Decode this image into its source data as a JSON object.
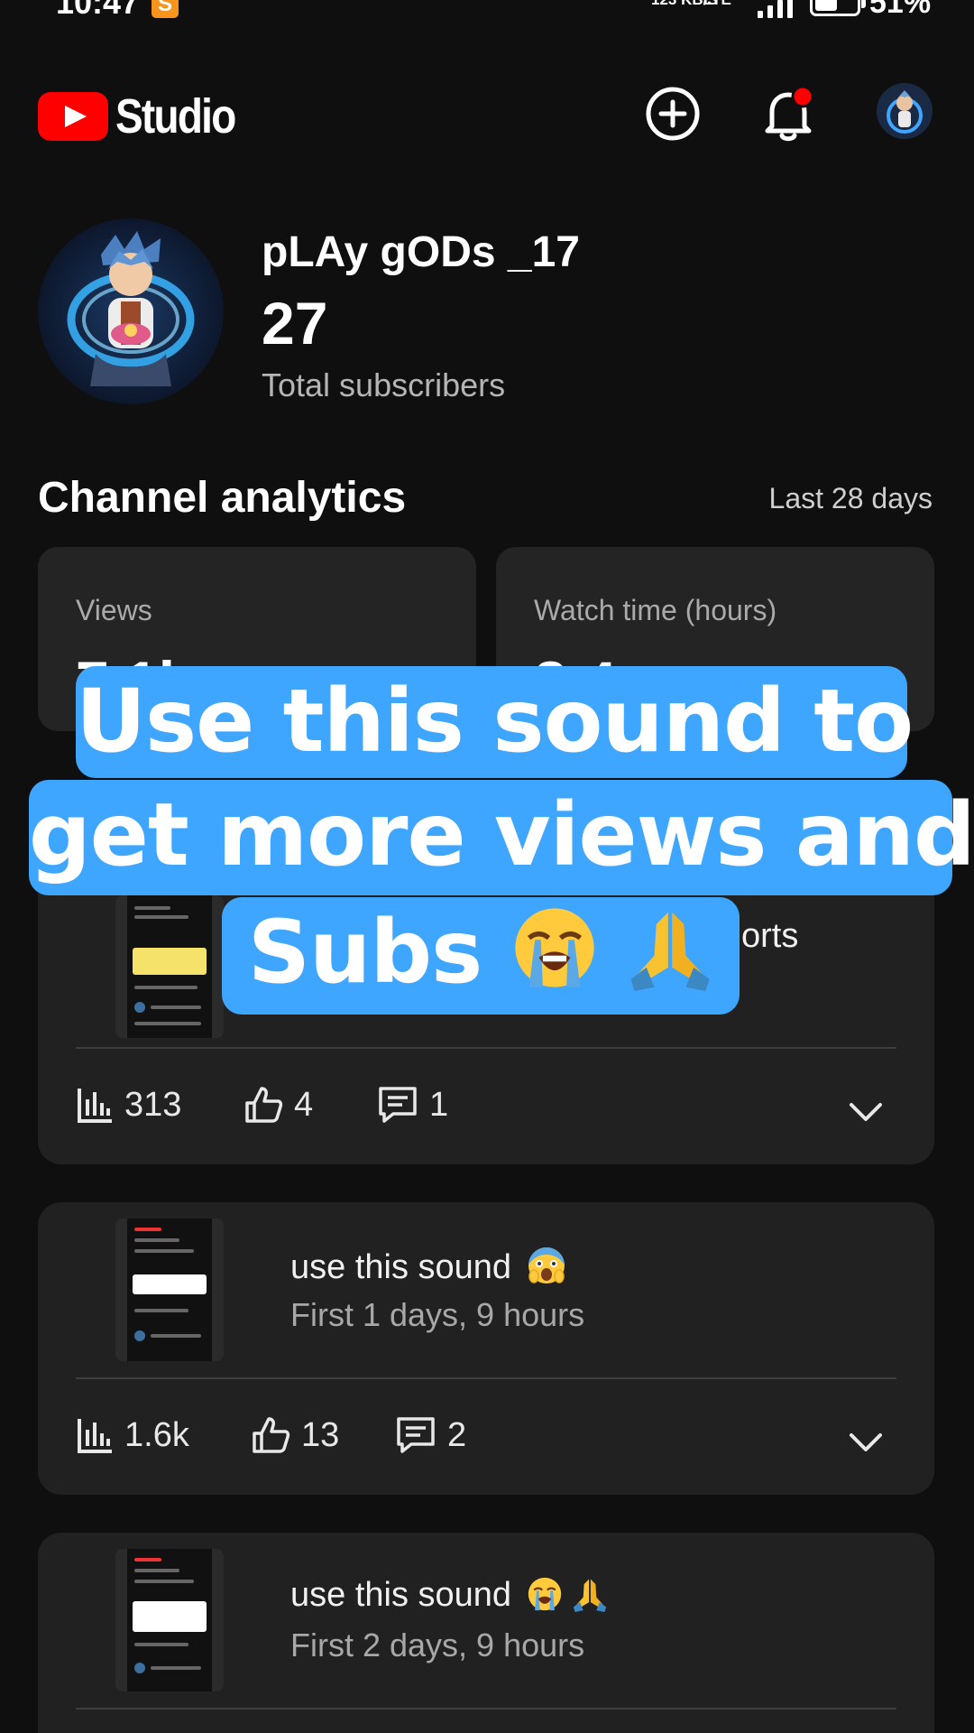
{
  "status_bar": {
    "time": "10:47",
    "app_badge": "S",
    "net_speed": "123 KB/S",
    "network_type": "LTE",
    "battery": "51%"
  },
  "header": {
    "brand": "Studio",
    "icons": [
      "create-icon",
      "notification-bell-icon",
      "account-avatar"
    ]
  },
  "channel": {
    "name": "pLAy gODs _17",
    "subscribers": "27",
    "subscribers_label": "Total subscribers"
  },
  "analytics": {
    "title": "Channel analytics",
    "range": "Last 28 days",
    "cards": [
      {
        "label": "Views",
        "value": "7.1k"
      },
      {
        "label": "Watch time (hours)",
        "value": "8.4"
      }
    ]
  },
  "overlay": {
    "line1": "Use this sound to",
    "line2": "get more views and",
    "line3": "Subs"
  },
  "videos": [
    {
      "title": "",
      "subtitle_visible": "orts",
      "views": "313",
      "likes": "4",
      "comments": "1"
    },
    {
      "title": "use this sound",
      "subtitle": "First 1 days, 9 hours",
      "views": "1.6k",
      "likes": "13",
      "comments": "2"
    },
    {
      "title": "use this sound",
      "subtitle": "First 2 days, 9 hours"
    }
  ],
  "colors": {
    "background": "#0f0f0f",
    "card": "#212121",
    "brand_red": "#ff0000",
    "overlay_blue": "#3ea6ff",
    "notification_dot": "#ff0000"
  }
}
